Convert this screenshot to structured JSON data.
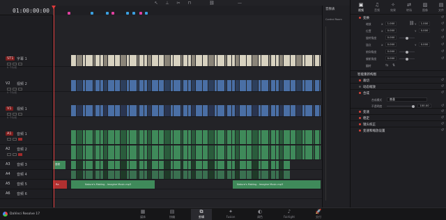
{
  "app": {
    "name": "DaVinci Resolve 17"
  },
  "timeline": {
    "timecode": "01:00:00:00",
    "mixer_title": "音频表",
    "room": "Control Room"
  },
  "tracks": [
    {
      "id": "ST1",
      "name": "字幕 1",
      "info": "0 个片段",
      "kind": "subtitle"
    },
    {
      "id": "V2",
      "name": "视频 2",
      "info": "0 个片段",
      "kind": "video"
    },
    {
      "id": "V1",
      "name": "视频 1",
      "info": "0 个片段",
      "kind": "video"
    },
    {
      "id": "A1",
      "name": "音频 1",
      "info": "2.0",
      "kind": "audio"
    },
    {
      "id": "A2",
      "name": "音频 2",
      "info": "2.0",
      "kind": "audio"
    },
    {
      "id": "A3",
      "name": "音频 3",
      "info": "2.0",
      "kind": "audio"
    },
    {
      "id": "A4",
      "name": "音频 4",
      "info": "2.0",
      "kind": "audio"
    },
    {
      "id": "A5",
      "name": "音频 5",
      "info": "2.0",
      "kind": "audio"
    },
    {
      "id": "A6",
      "name": "音频 6",
      "info": "2.0",
      "kind": "audio"
    }
  ],
  "clips": {
    "audio_a": "Nature's Making - Imagine Music.mp3",
    "audio_b": "Nature's Making - Imagine Music.mp3",
    "small_label": "Ra",
    "small_label_2": "音频"
  },
  "inspector": {
    "tabs": [
      "视频",
      "音频",
      "效果",
      "转场",
      "图像",
      "文件"
    ],
    "active_tab": "视频",
    "transform_label": "变换",
    "params": {
      "zoom": {
        "label": "缩放",
        "x": "1.000",
        "y": "1.000"
      },
      "position": {
        "label": "位置",
        "x": "0.000",
        "y": "0.000"
      },
      "rotation": {
        "label": "旋转角度",
        "value": "0.000"
      },
      "anchor": {
        "label": "锚点",
        "x": "0.000",
        "y": "0.000"
      },
      "pitch": {
        "label": "俯仰角度",
        "value": "0.000"
      },
      "yaw": {
        "label": "偏航角度",
        "value": "0.000"
      },
      "flip": {
        "label": "翻转"
      }
    },
    "sections": {
      "smart_reframe": "智能重新构图",
      "crop": "裁切",
      "dynamic_zoom": "动态缩放",
      "composite": "合成",
      "composite_mode_label": "合成模式",
      "composite_mode_value": "普通",
      "opacity_label": "不透明度",
      "opacity_value": "100.00",
      "speed": "变速",
      "stabilization": "稳定",
      "lens_correction": "镜头校正",
      "retime_scaling": "变速和缩放设置"
    }
  },
  "pages": [
    {
      "label": "媒体",
      "glyph": "▦"
    },
    {
      "label": "快编",
      "glyph": "▤"
    },
    {
      "label": "剪辑",
      "glyph": "⧉"
    },
    {
      "label": "Fusion",
      "glyph": "✦"
    },
    {
      "label": "调色",
      "glyph": "◐"
    },
    {
      "label": "Fairlight",
      "glyph": "♪"
    },
    {
      "label": "交付",
      "glyph": "🚀"
    }
  ],
  "active_page": "剪辑",
  "colors": {
    "accent_red": "#e03a3a",
    "audio_green": "#3f8a5a",
    "video_blue": "#4a6fa5",
    "subtitle_cream": "#d8d2c0",
    "marker_pink": "#e040a0",
    "marker_blue": "#3aa0e0"
  }
}
